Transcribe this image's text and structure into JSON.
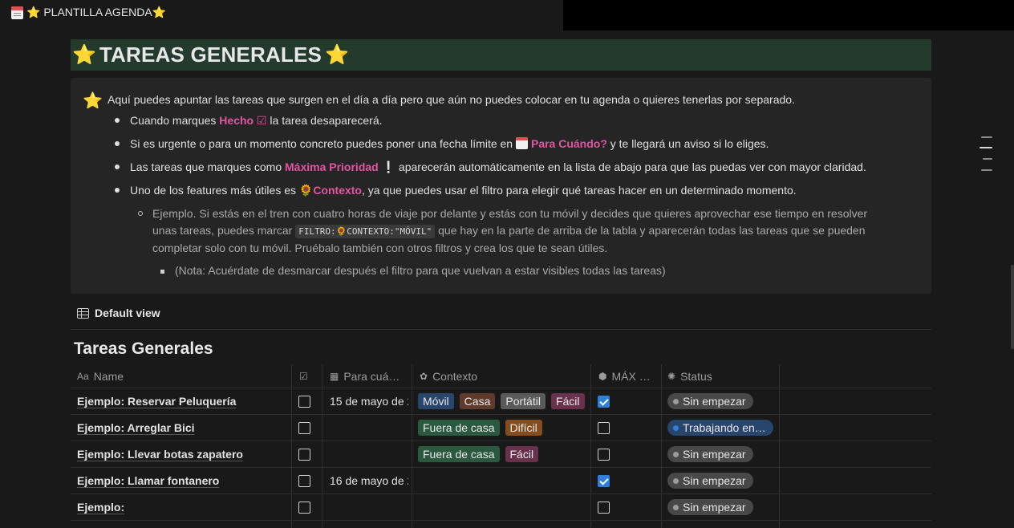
{
  "topbar": {
    "breadcrumb": "⭐ PLANTILLA AGENDA⭐"
  },
  "page": {
    "title": "TAREAS GENERALES"
  },
  "callout": {
    "intro": "Aquí puedes apuntar las tareas que surgen en el día a día pero que aún no puedes colocar en tu agenda o quieres tenerlas por separado.",
    "b1_pre": "Cuando marques ",
    "b1_hl": "Hecho ☑",
    "b1_post": " la tarea desaparecerá.",
    "b2_pre": "Si es urgente o para un momento concreto puedes poner una fecha límite en ",
    "b2_hl": "Para Cuándo?",
    "b2_post": " y te llegará un aviso si lo eliges.",
    "b3_pre": "Las tareas que marques como ",
    "b3_hl": "Máxima Prioridad",
    "b3_mark": "❕",
    "b3_post": " aparecerán automáticamente en la lista de abajo para que las puedas ver con mayor claridad.",
    "b4_pre": "Uno de los features más útiles es ",
    "b4_hl": "🌻Contexto",
    "b4_post": ", ya que puedes usar el filtro para elegir qué tareas hacer en un determinado momento.",
    "sub_line1": "Ejemplo. Si estás en el tren con cuatro horas de viaje por delante y estás con tu móvil y decides que quieres aprovechar ese tiempo en resolver",
    "sub_line2_pre": "unas tareas, puedes marcar ",
    "sub_code": "FILTRO:🌻CONTEXTO:\"MÓVIL\"",
    "sub_line2_post": " que hay en la parte de arriba de la tabla y aparecerán todas las tareas que se pueden",
    "sub_line3": "completar solo con tu móvil. Pruébalo también con otros filtros y crea los que te sean útiles.",
    "note": "(Nota: Acuérdate de desmarcar después el filtro para que vuelvan a estar visibles todas las tareas)"
  },
  "view": {
    "tab_label": "Default view"
  },
  "database": {
    "title": "Tareas Generales",
    "columns": {
      "name": "Name",
      "para": "Para cuá…",
      "contexto": "Contexto",
      "max": "MÁX …",
      "status": "Status"
    },
    "rows": [
      {
        "name": "Ejemplo: Reservar Peluquería",
        "done": false,
        "date": "15 de mayo de 2",
        "tags": [
          "Móvil",
          "Casa",
          "Portátil",
          "Fácil"
        ],
        "max": true,
        "status": "Sin empezar"
      },
      {
        "name": "Ejemplo: Arreglar Bici",
        "done": false,
        "date": "",
        "tags": [
          "Fuera de casa",
          "Difícil"
        ],
        "max": false,
        "status": "Trabajando en…"
      },
      {
        "name": "Ejemplo: Llevar botas zapatero",
        "done": false,
        "date": "",
        "tags": [
          "Fuera de casa",
          "Fácil"
        ],
        "max": false,
        "status": "Sin empezar"
      },
      {
        "name": "Ejemplo: Llamar fontanero",
        "done": false,
        "date": "16 de mayo de 2",
        "tags": [],
        "max": true,
        "status": "Sin empezar"
      },
      {
        "name": "Ejemplo:",
        "done": false,
        "date": "",
        "tags": [],
        "max": false,
        "status": "Sin empezar"
      }
    ]
  },
  "colors": {
    "background": "#191919",
    "heading_bg": "#233a2c",
    "callout_bg": "#252525",
    "highlight": "#e255a1",
    "checkbox_on": "#2e7fd9"
  }
}
